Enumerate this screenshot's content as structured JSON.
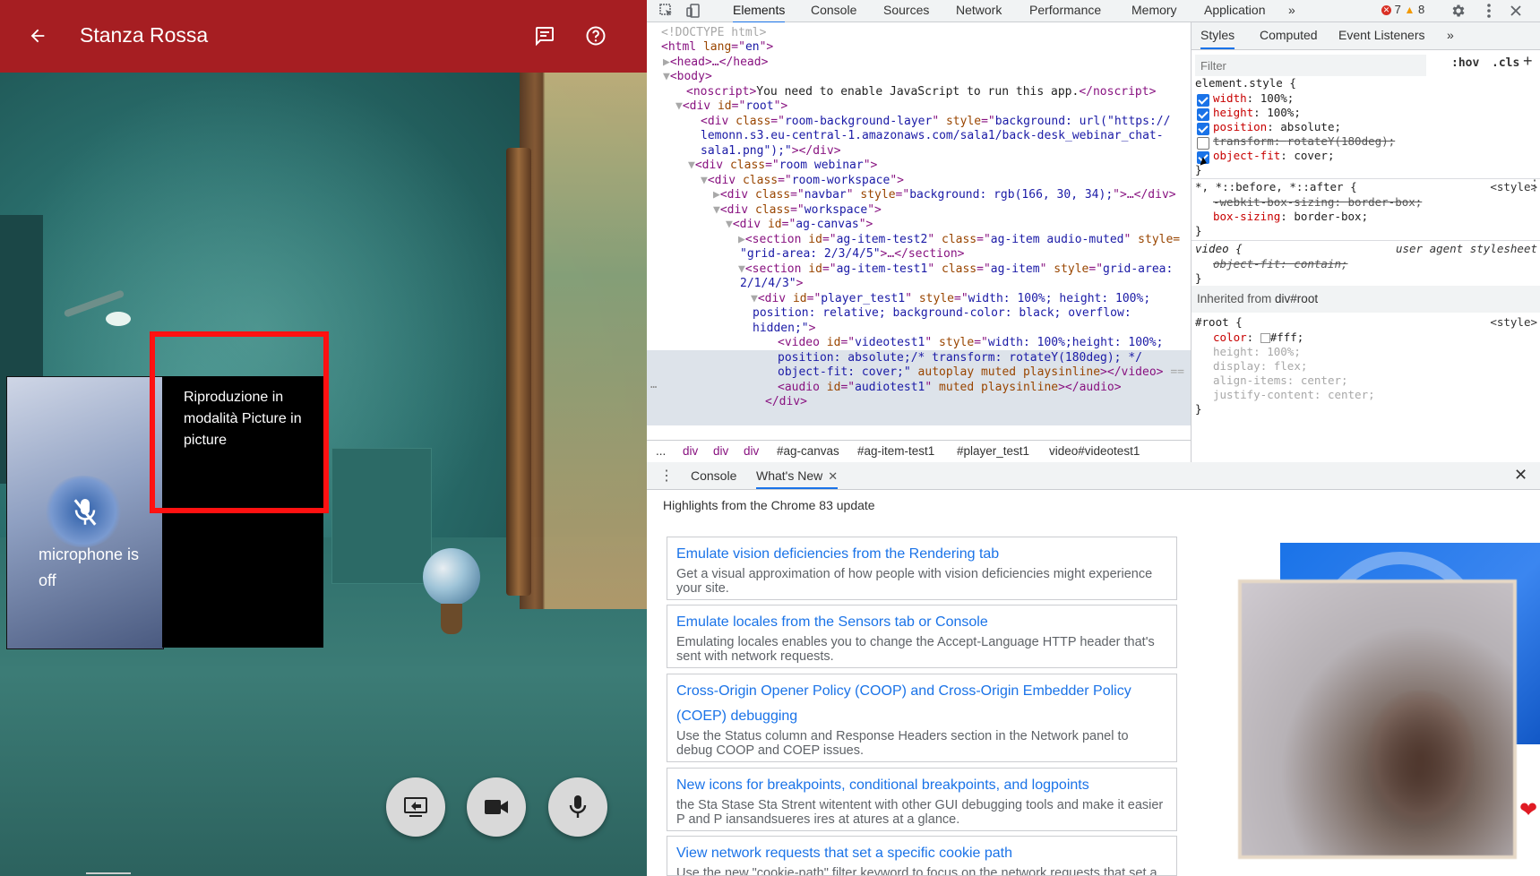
{
  "app": {
    "title": "Stanza Rossa",
    "navbar_color": "#a61e22",
    "back_icon": "arrow-left-icon",
    "chat_icon": "chat-icon",
    "help_icon": "help-circle-icon",
    "participant": {
      "mic_status": "microphone is off",
      "mic_icon": "mic-off-icon"
    },
    "pip_message": "Riproduzione in modalità Picture in picture",
    "highlight_color": "#ff1111",
    "controls": [
      {
        "name": "share-screen-button",
        "icon": "screen-share-icon"
      },
      {
        "name": "camera-button",
        "icon": "videocam-icon"
      },
      {
        "name": "microphone-button",
        "icon": "mic-icon"
      }
    ]
  },
  "devtools": {
    "tabs": [
      "Elements",
      "Console",
      "Sources",
      "Network",
      "Performance",
      "Memory",
      "Application"
    ],
    "active_tab": "Elements",
    "more_tabs": "»",
    "errors": "7",
    "warnings": "8",
    "dom_lines": {
      "l1": "<!DOCTYPE html>",
      "l2a": "<html ",
      "l2b": "lang",
      "l2c": "=\"",
      "l2d": "en",
      "l2e": "\">",
      "l3": "<head>…</head>",
      "l4": "<body>",
      "l5a": "<noscript>",
      "l5b": "You need to enable JavaScript to run this app.",
      "l5c": "</noscript>",
      "l6a": "<div ",
      "l6b": "id",
      "l6c": "root",
      "l6d": "\">",
      "l7a": "<div ",
      "l7b": "class",
      "l7c": "room-background-layer",
      "l7d": " style",
      "l7e": "background: url(\"https://",
      "l8": "lemonn.s3.eu-central-1.amazonaws.com/sala1/back-desk_webinar_chat-",
      "l9a": "sala1.png\");\"",
      "l9b": "></div>",
      "l10a": "<div ",
      "l10b": "class",
      "l10c": "room webinar",
      "l10d": "\">",
      "l11a": "<div ",
      "l11b": "class",
      "l11c": "room-workspace",
      "l11d": "\">",
      "l12a": "<div ",
      "l12b": "class",
      "l12c": "navbar",
      "l12d": " style",
      "l12e": "background: rgb(166, 30, 34);",
      "l12f": "\">…</div>",
      "l13a": "<div ",
      "l13b": "class",
      "l13c": "workspace",
      "l13d": "\">",
      "l14a": "<div ",
      "l14b": "id",
      "l14c": "ag-canvas",
      "l14d": "\">",
      "l15a": "<section ",
      "l15b": "id",
      "l15c": "ag-item-test2",
      "l15d": " class",
      "l15e": "ag-item audio-muted",
      "l15f": " style=",
      "l16a": "\"grid-area: 2/3/4/5\"",
      "l16b": ">…</section>",
      "l17a": "<section ",
      "l17b": "id",
      "l17c": "ag-item-test1",
      "l17d": " class",
      "l17e": "ag-item",
      "l17f": " style",
      "l17g": "grid-area:",
      "l18a": "2/1/4/3\"",
      "l18b": ">",
      "l19a": "<div ",
      "l19b": "id",
      "l19c": "player_test1",
      "l19d": " style",
      "l19e": "width: 100%; height: 100%;",
      "l20": "position: relative; background-color: black; overflow:",
      "l21a": "hidden;\"",
      "l21b": ">",
      "l22a": "<video ",
      "l22b": "id",
      "l22c": "videotest1",
      "l22d": " style",
      "l22e": "width: 100%;height: 100%;",
      "l23": "position: absolute;/* transform: rotateY(180deg); */",
      "l24a": "object-fit: cover;\"",
      "l24b": " autoplay muted playsinline",
      "l24c": "></video>",
      "l24d": " ==",
      "l25a": "<audio ",
      "l25b": "id",
      "l25c": "audiotest1",
      "l25d": " muted playsinline",
      "l25e": "></audio>",
      "l26": "</div>",
      "dots": "…"
    },
    "breadcrumbs": [
      "...",
      "div",
      "div",
      "div",
      "#ag-canvas",
      "#ag-item-test1",
      "#player_test1",
      "video#videotest1"
    ],
    "styles": {
      "tabs": [
        "Styles",
        "Computed",
        "Event Listeners",
        "»"
      ],
      "filter_placeholder": "Filter",
      "hov": ":hov",
      "cls": ".cls",
      "plus": "+",
      "element_style": "element.style {",
      "rules": [
        {
          "prop": "width",
          "val": "100%;",
          "checked": true
        },
        {
          "prop": "height",
          "val": "100%;",
          "checked": true
        },
        {
          "prop": "position",
          "val": "absolute;",
          "checked": true
        },
        {
          "prop": "transform",
          "val": "rotateY(180deg);",
          "checked": false
        },
        {
          "prop": "object-fit",
          "val": "cover;",
          "checked": true
        }
      ],
      "close_brace": "}",
      "universal_selector": "*, *::before, *::after {",
      "universal_src": "<style>",
      "webkit_box_sizing": "-webkit-box-sizing: border-box;",
      "box_sizing_prop": "box-sizing",
      "box_sizing_val": "border-box;",
      "video_selector": "video {",
      "video_src": "user agent stylesheet",
      "video_rule": "object-fit: contain;",
      "inherited_label": "Inherited from ",
      "inherited_target": "div#root",
      "root_selector": "#root {",
      "root_src": "<style>",
      "root_rules": [
        {
          "prop": "color",
          "val": "#fff;"
        },
        {
          "prop": "height",
          "val": "100%;"
        },
        {
          "prop": "display",
          "val": "flex;"
        },
        {
          "prop": "align-items",
          "val": "center;"
        },
        {
          "prop": "justify-content",
          "val": "center;"
        }
      ]
    },
    "drawer": {
      "tabs": [
        "Console",
        "What's New"
      ],
      "active_tab": "What's New",
      "close": "✕",
      "heading": "Highlights from the Chrome 83 update",
      "items": [
        {
          "title": "Emulate vision deficiencies from the Rendering tab",
          "desc": "Get a visual approximation of how people with vision deficiencies might experience your site."
        },
        {
          "title": "Emulate locales from the Sensors tab or Console",
          "desc": "Emulating locales enables you to change the Accept-Language HTTP header that's sent with network requests."
        },
        {
          "title": "Cross-Origin Opener Policy (COOP) and Cross-Origin Embedder Policy (COEP) debugging",
          "desc": "Use the Status column and Response Headers section in the Network panel to debug COOP and COEP issues."
        },
        {
          "title": "New icons for breakpoints, conditional breakpoints, and logpoints",
          "desc": "the Sta Stase Sta Strent witentent with other GUI debugging tools and make it easier P and P iansandsueres ires at atures at a glance."
        },
        {
          "title": "View network requests that set a specific cookie path",
          "desc": "Use the new \"cookie-path\" filter keyword to focus on the network requests that set a"
        }
      ]
    }
  }
}
